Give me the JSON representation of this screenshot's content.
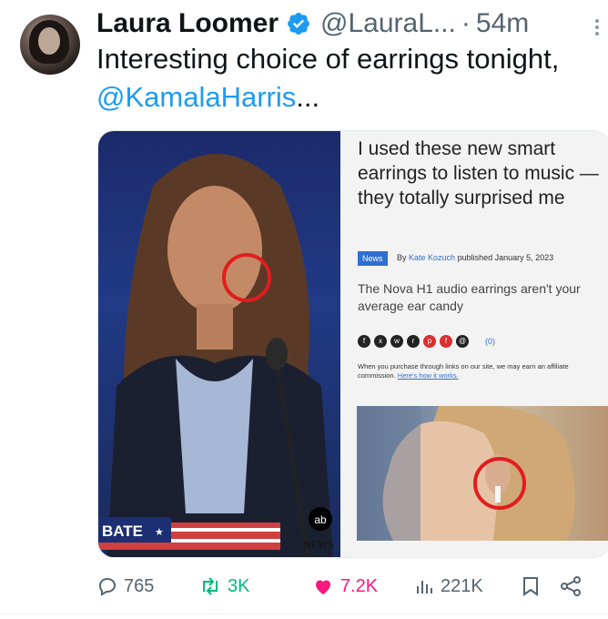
{
  "tweet": {
    "author_name": "Laura Loomer",
    "handle": "@LauraL...",
    "separator": "·",
    "time": "54m",
    "text_before": "Interesting choice of earrings tonight, ",
    "mention": "@KamalaHarris",
    "text_after": "..."
  },
  "media": {
    "left_photo": {
      "lower_third_text": "BATE",
      "lower_third_star": "★",
      "network_logo": "ab",
      "network_logo_sub": "NEWS"
    },
    "article": {
      "title": "I used these new smart earrings to listen to music — they totally surprised me",
      "tag": "News",
      "byline_prefix": "By",
      "author": "Kate Kozuch",
      "byline_suffix": "published January 5, 2023",
      "subtitle": "The Nova H1 audio earrings aren't your average ear candy",
      "comments": "(0)",
      "disclaimer": "When you purchase through links on our site, we may earn an affiliate commission.",
      "disclaimer_link": "Here's how it works."
    }
  },
  "actions": {
    "replies": "765",
    "retweets": "3K",
    "likes": "7.2K",
    "views": "221K"
  },
  "colors": {
    "accent": "#1d9bf0",
    "like": "#f91880",
    "retweet": "#00ba7c",
    "highlight_ring": "#e11d1d"
  }
}
